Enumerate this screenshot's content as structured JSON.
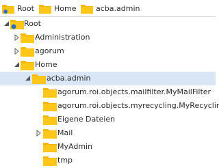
{
  "breadcrumb": {
    "items": [
      {
        "label": "Root",
        "icon": "root-folder-icon"
      },
      {
        "label": "Home",
        "icon": "folder-icon"
      },
      {
        "label": "acba.admin",
        "icon": "folder-icon"
      }
    ]
  },
  "tree": {
    "nodes": [
      {
        "label": "Root",
        "level": 0,
        "expanded": true,
        "icon": "root-folder-icon"
      },
      {
        "label": "Administration",
        "level": 1,
        "expanded": false,
        "icon": "folder-icon"
      },
      {
        "label": "agorum",
        "level": 1,
        "expanded": false,
        "icon": "folder-icon"
      },
      {
        "label": "Home",
        "level": 1,
        "expanded": true,
        "icon": "folder-icon"
      },
      {
        "label": "acba.admin",
        "level": 2,
        "expanded": true,
        "selected": true,
        "icon": "folder-icon"
      },
      {
        "label": "agorum.roi.objects.mailfilter.MyMailFilter",
        "level": 3,
        "icon": "folder-icon"
      },
      {
        "label": "agorum.roi.objects.myrecycling.MyRecycling",
        "level": 3,
        "icon": "folder-icon"
      },
      {
        "label": "Eigene Dateien",
        "level": 3,
        "icon": "folder-icon"
      },
      {
        "label": "Mail",
        "level": 3,
        "expanded": false,
        "icon": "folder-icon"
      },
      {
        "label": "MyAdmin",
        "level": 3,
        "icon": "folder-icon"
      },
      {
        "label": "tmp",
        "level": 3,
        "icon": "folder-icon"
      }
    ]
  },
  "colors": {
    "folder": "#f5b800",
    "folder_dark": "#d99e00",
    "root_badge": "#2f6fc0",
    "selection": "#d9e6f5",
    "arrow": "#666666"
  }
}
